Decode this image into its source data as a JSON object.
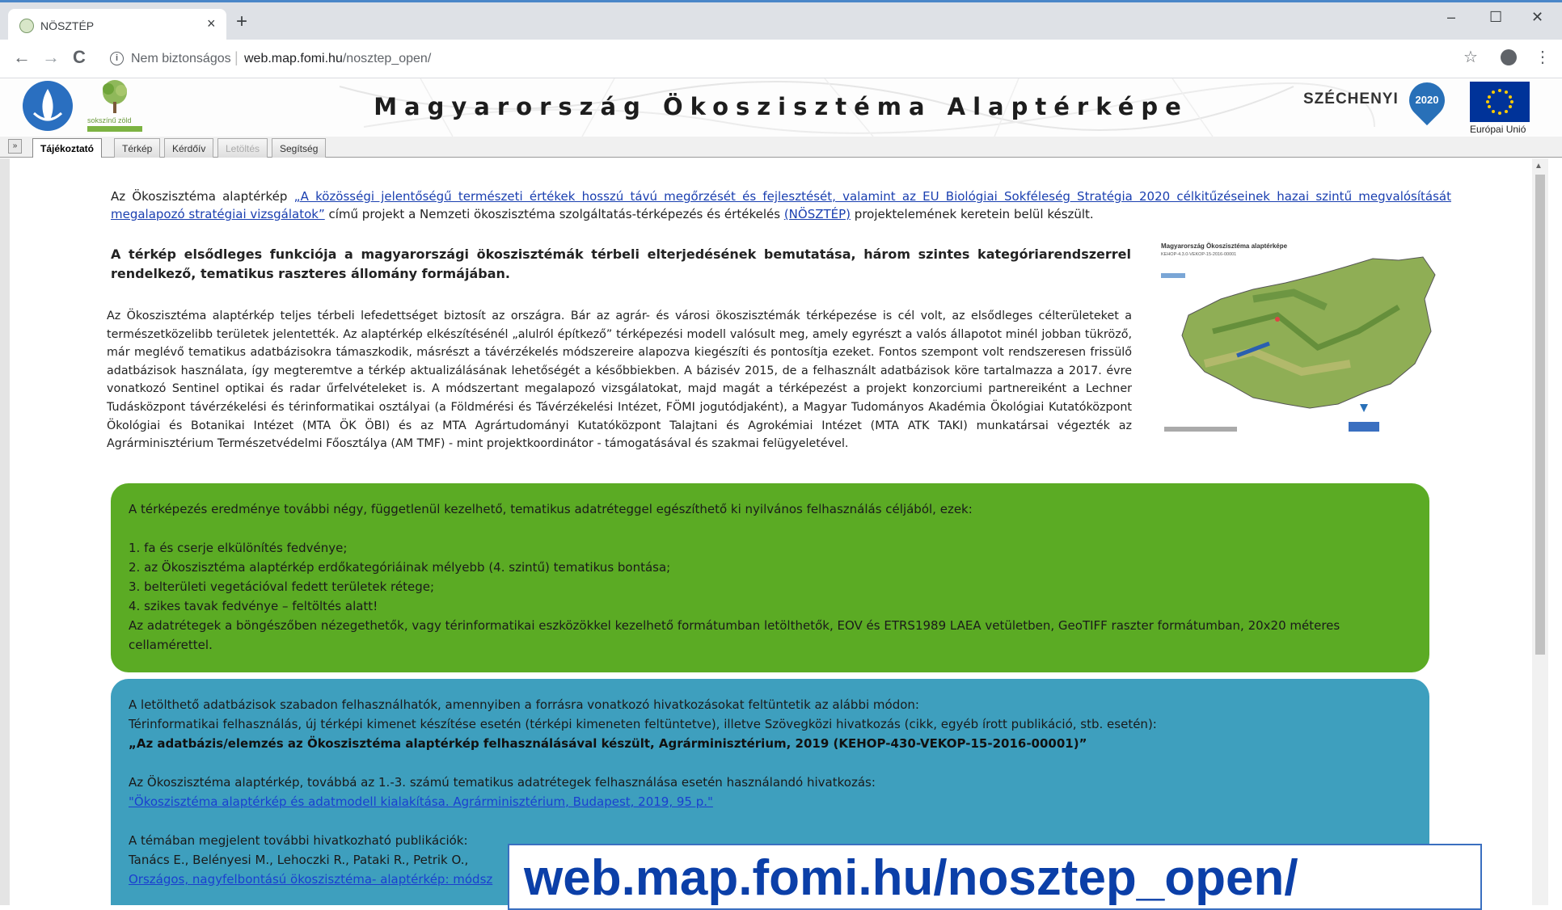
{
  "browser": {
    "tab_title": "NÖSZTÉP",
    "tab_close": "×",
    "new_tab": "+",
    "win_min": "–",
    "win_max": "☐",
    "win_close": "✕",
    "nav_back": "←",
    "nav_forward": "→",
    "nav_reload": "C",
    "security": "Nem biztonságos",
    "url_host": "web.map.fomi.hu",
    "url_path": "/nosztep_open/",
    "star": "☆",
    "menu": "⋮",
    "info": "i",
    "accent_color": "#4a86c8"
  },
  "header": {
    "tree_logo_text": "sokszínű zöld",
    "title": "Magyarország Ökoszisztéma Alaptérképe",
    "szechenyi": "SZÉCHENYI",
    "szechenyi_year": "2020",
    "eu_label": "Európai Unió"
  },
  "tabs": [
    {
      "label": "Tájékoztató",
      "active": true
    },
    {
      "label": "Térkép"
    },
    {
      "label": "Kérdőív"
    },
    {
      "label": "Letöltés",
      "disabled": true
    },
    {
      "label": "Segítség"
    }
  ],
  "expander": "»",
  "intro": {
    "pre": "Az Ökoszisztéma alaptérkép ",
    "link1": "„A közösségi jelentőségű természeti értékek hosszú távú megőrzését és fejlesztését, valamint az EU Biológiai Sokféleség Stratégia 2020 célkitűzéseinek hazai szintű megvalósítását megalapozó stratégiai vizsgálatok”",
    "mid": " című projekt a Nemzeti ökoszisztéma szolgáltatás-térképezés és értékelés ",
    "link2": "(NÖSZTÉP)",
    "post": " projektelemének keretein belül készült."
  },
  "bold_para": "A térkép elsődleges funkciója a magyarországi ökoszisztémák térbeli elterjedésének bemutatása, három szintes kategóriarendszerrel rendelkező, tematikus raszteres állomány formájában.",
  "long_para": "Az Ökoszisztéma alaptérkép teljes térbeli lefedettséget biztosít az országra. Bár az agrár- és városi ökoszisztémák térképezése is cél volt, az elsődleges célterületeket a természetközelibb területek jelentették. Az alaptérkép elkészítésénél „alulról építkező” térképezési modell valósult meg, amely egyrészt a valós állapotot minél jobban tükröző, már meglévő tematikus adatbázisokra támaszkodik, másrészt a távérzékelés módszereire alapozva kiegészíti és pontosítja ezeket. Fontos szempont volt rendszeresen frissülő adatbázisok használata, így megteremtve a térkép aktualizálásának lehetőségét a későbbiekben. A bázisév 2015, de a felhasznált adatbázisok köre tartalmazza a 2017. évre vonatkozó Sentinel optikai és radar űrfelvételeket is. A módszertant megalapozó vizsgálatokat, majd magát a térképezést a projekt konzorciumi partnereiként a Lechner Tudásközpont távérzékelési és térinformatikai osztályai (a Földmérési és Távérzékelési Intézet, FÖMI jogutódjaként), a Magyar Tudományos Akadémia Ökológiai Kutatóközpont Ökológiai és Botanikai Intézet (MTA ÖK ÖBI) és az MTA Agrártudományi Kutatóközpont Talajtani és Agrokémiai Intézet (MTA ATK TAKI) munkatársai végezték az Agrárminisztérium Természetvédelmi Főosztálya (AM TMF) - mint projektkoordinátor - támogatásával és szakmai felügyeletével.",
  "map_thumb": {
    "title": "Magyarország Ökoszisztéma alaptérképe",
    "code": "KEHOP-4.3.0-VEKOP-15-2016-00001"
  },
  "green_box": {
    "intro": "A térképezés eredménye további négy, függetlenül kezelhető, tematikus adatréteggel egészíthető ki nyilvános felhasználás céljából, ezek:",
    "items": [
      "1. fa és cserje elkülönítés fedvénye;",
      "2. az Ökoszisztéma alaptérkép erdőkategóriáinak mélyebb (4. szintű) tematikus bontása;",
      "3. belterületi vegetációval fedett területek rétege;",
      "4. szikes tavak fedvénye – feltöltés alatt!"
    ],
    "outro": "Az adatrétegek a böngészőben nézegethetők, vagy térinformatikai eszközökkel kezelhető formátumban letölthetők, EOV és ETRS1989 LAEA vetületben, GeoTIFF raszter formátumban, 20x20 méteres cellamérettel."
  },
  "blue_box": {
    "line1": "A letölthető adatbázisok szabadon felhasználhatók, amennyiben a forrásra vonatkozó hivatkozásokat feltüntetik az alábbi módon:",
    "line2": "Térinformatikai felhasználás, új térképi kimenet készítése esetén (térképi kimeneten feltüntetve), illetve Szövegközi hivatkozás (cikk, egyéb írott publikáció, stb. esetén):",
    "citation": "„Az adatbázis/elemzés az Ökoszisztéma alaptérkép felhasználásával készült, Agrárminisztérium, 2019 (KEHOP-430-VEKOP-15-2016-00001)”",
    "line3": "Az Ökoszisztéma alaptérkép, továbbá az 1.-3. számú tematikus adatrétegek felhasználása esetén használandó hivatkozás:",
    "link3": "\"Ökoszisztéma alaptérkép és adatmodell kialakítása. Agrárminisztérium, Budapest, 2019, 95 p.\"",
    "line4": "A témában megjelent további hivatkozható publikációk:",
    "line5": "Tanács E., Belényesi M., Lehoczki R., Pataki R., Petrik O.,",
    "link5": "Országos, nagyfelbontású ökoszisztéma- alaptérkép: módsz"
  },
  "overlay_url": "web.map.fomi.hu/nosztep_open/"
}
